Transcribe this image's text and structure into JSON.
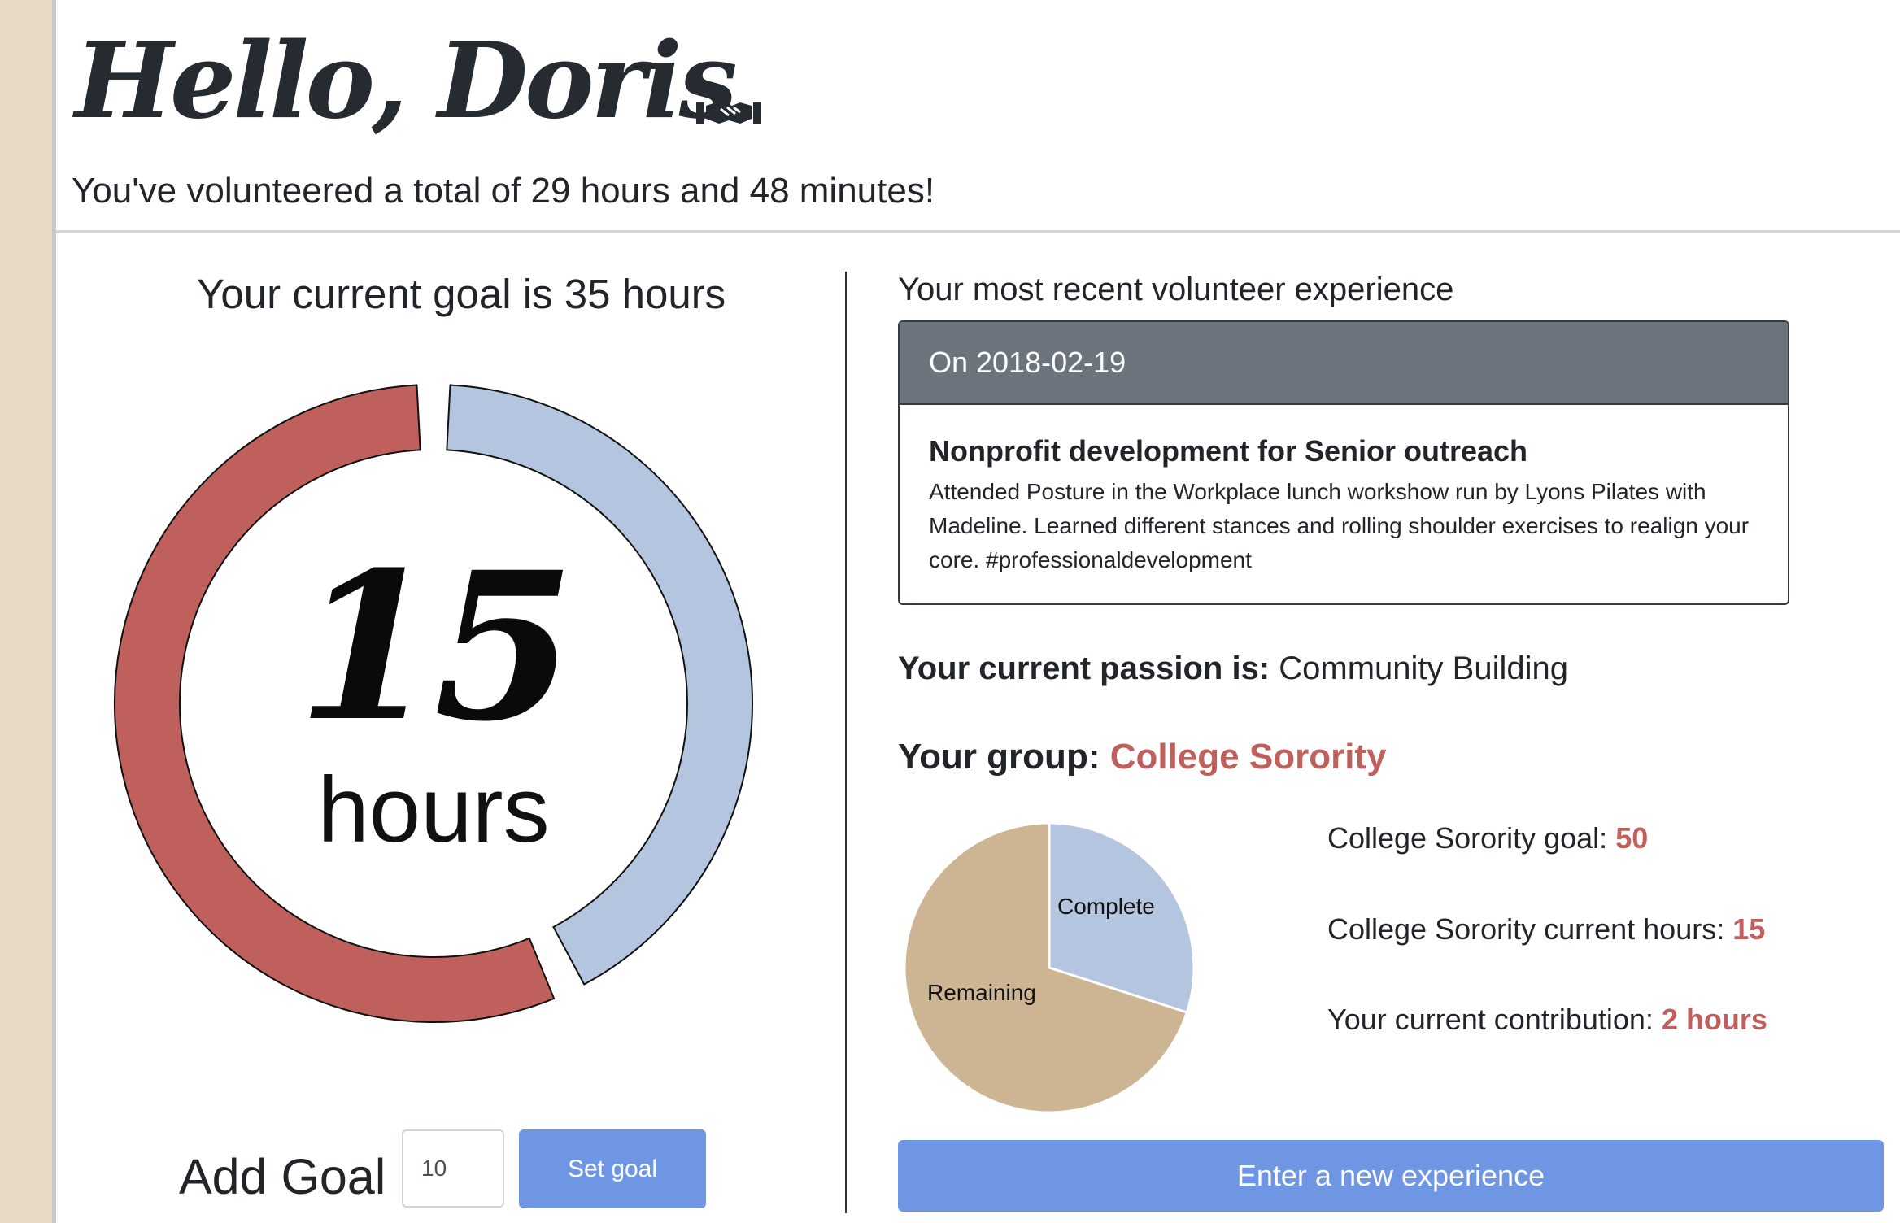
{
  "header": {
    "greeting": "Hello, Doris",
    "total_line": "You've volunteered a total of 29 hours and 48 minutes!"
  },
  "goal": {
    "heading": "Your current goal is 35 hours",
    "donut_value": "15",
    "donut_unit": "hours",
    "remaining_fraction": 0.57,
    "complete_fraction": 0.43,
    "colors": {
      "remaining": "#c0605d",
      "complete": "#b4c5df"
    },
    "add_goal_label": "Add Goal",
    "input_value": "10",
    "set_goal_label": "Set goal"
  },
  "recent": {
    "heading": "Your most recent volunteer experience",
    "date_label": "On 2018-02-19",
    "title": "Nonprofit development for Senior outreach",
    "description": "Attended Posture in the Workplace lunch workshow run by Lyons Pilates with Madeline. Learned different stances and rolling shoulder exercises to realign your core. #professionaldevelopment"
  },
  "passion": {
    "label": "Your current passion is:",
    "value": "Community Building"
  },
  "group": {
    "label": "Your group:",
    "name": "College Sorority",
    "goal_label": "College Sorority goal:",
    "goal_value": "50",
    "current_label": "College Sorority current hours:",
    "current_value": "15",
    "contribution_label": "Your current contribution:",
    "contribution_value": "2 hours"
  },
  "pie": {
    "complete_label": "Complete",
    "remaining_label": "Remaining",
    "complete_fraction": 0.3,
    "colors": {
      "complete": "#b4c5df",
      "remaining": "#cdb492"
    }
  },
  "new_experience_label": "Enter a new experience"
}
